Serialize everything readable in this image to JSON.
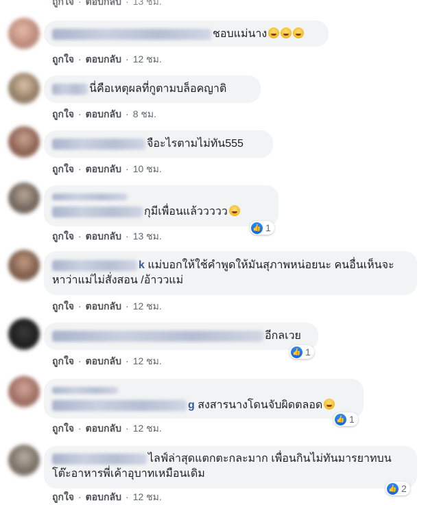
{
  "labels": {
    "like": "ถูกใจ",
    "reply": "ตอบกลับ",
    "separator": "·"
  },
  "colors": {
    "bubble": "#f2f3f5",
    "like_blue": "#1877f2",
    "meta_gray": "#606770"
  },
  "icons": {
    "reaction": "like-thumb-icon",
    "emoji": "laughing-emoji-icon"
  },
  "top_partial": {
    "time": "13 ชม."
  },
  "comments": [
    {
      "text": "ชอบแม่นาง",
      "emoji_count": 3,
      "time": "12 ชม.",
      "reactions": null
    },
    {
      "text": "นี่คือเหตุผลที่กูตามบล็อคญาติ",
      "emoji_count": 0,
      "time": "8 ชม.",
      "reactions": null
    },
    {
      "text": "จือะไรตามไม่ทัน555",
      "emoji_count": 0,
      "time": "10 ชม.",
      "reactions": null
    },
    {
      "text": "กุมีเพื่อนแล้ววววว",
      "emoji_count": 1,
      "time": "13 ชม.",
      "reactions": "1"
    },
    {
      "name_tail": "k",
      "text": "แม่บอกให้ใช้คำพูดให้มันสุภาพหน่อยนะ คนอื่นเห็นจะหาว่าแม่ไม่สั่งสอน /อ้าววแม่",
      "emoji_count": 0,
      "time": "12 ชม.",
      "reactions": null
    },
    {
      "text": "อีกลเวย",
      "emoji_count": 0,
      "time": "12 ชม.",
      "reactions": "1"
    },
    {
      "name_tail": "g",
      "text": "สงสารนางโดนจับผิดตลอด",
      "emoji_count": 1,
      "time": "12 ชม.",
      "reactions": "1"
    },
    {
      "text": "ไลฟ์ล่าสุดแตกตะกละมาก เพื่อนกินไม่ทันมารยาทบนโต๊ะอาหารพี่เค้าอุบาทเหมือนเดิม",
      "emoji_count": 0,
      "time": "12 ชม.",
      "reactions": "2"
    }
  ]
}
